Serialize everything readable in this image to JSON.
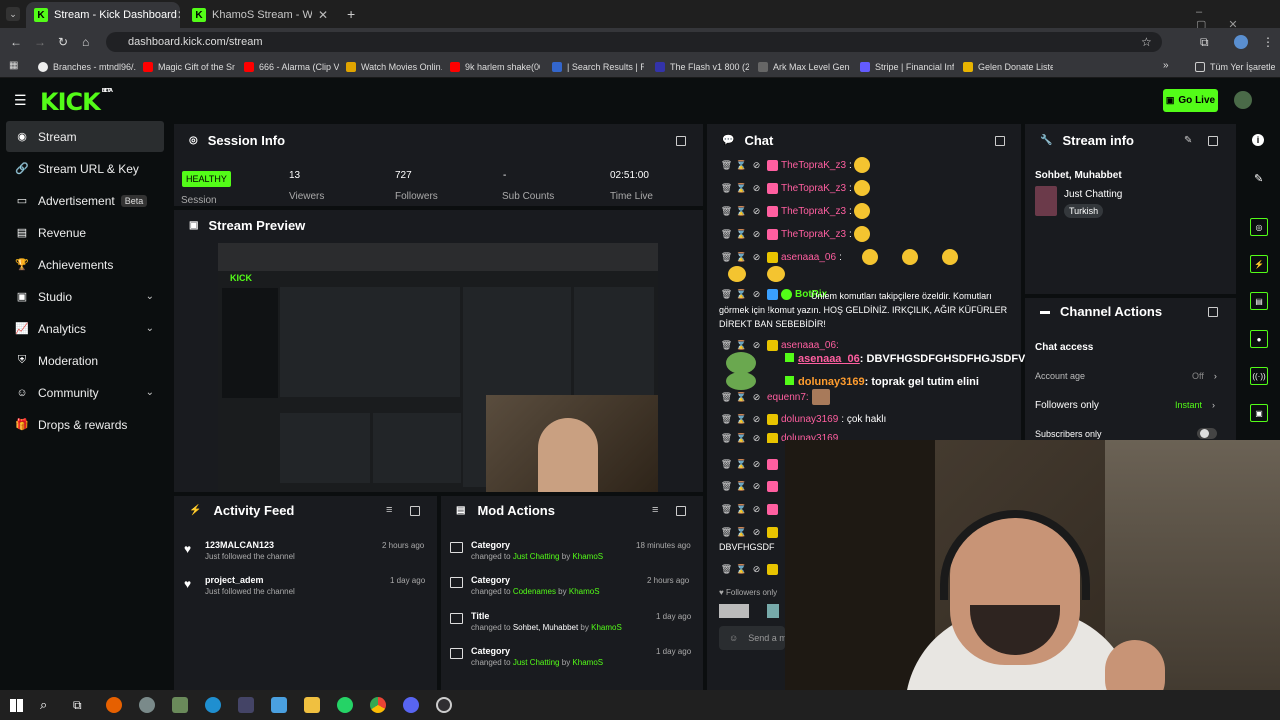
{
  "browser": {
    "tabs": [
      {
        "label": "Stream - Kick Dashboard"
      },
      {
        "label": "KhamoS Stream - Watch Live"
      }
    ],
    "url": "dashboard.kick.com/stream",
    "bookmarks": [
      "Branches - mtndl96/...",
      "Magic Gift of the Sn...",
      "666 - Alarma (Clip V...",
      "Watch Movies Onlin...",
      "9k harlem shake(00...",
      "| Search Results | Re...",
      "The Flash v1 800 (20...",
      "Ark Max Level Gene...",
      "Stripe | Financial Infr...",
      "Gelen Donate Listesi",
      "Tüm Yer İşaretleri"
    ]
  },
  "header": {
    "logo": "KICK",
    "logo_sup": "BETA",
    "go_live": "Go Live"
  },
  "sidebar": {
    "items": [
      {
        "label": "Stream"
      },
      {
        "label": "Stream URL & Key"
      },
      {
        "label": "Advertisement",
        "badge": "Beta"
      },
      {
        "label": "Revenue"
      },
      {
        "label": "Achievements"
      },
      {
        "label": "Studio"
      },
      {
        "label": "Analytics"
      },
      {
        "label": "Moderation"
      },
      {
        "label": "Community"
      },
      {
        "label": "Drops & rewards"
      }
    ]
  },
  "session": {
    "title": "Session Info",
    "status": "HEALTHY",
    "status_label": "Session",
    "viewers": "13",
    "viewers_label": "Viewers",
    "followers": "727",
    "followers_label": "Followers",
    "subs": "-",
    "subs_label": "Sub Counts",
    "time": "02:51:00",
    "time_label": "Time Live"
  },
  "preview": {
    "title": "Stream Preview"
  },
  "activity": {
    "title": "Activity Feed",
    "items": [
      {
        "name": "123MALCAN123",
        "sub": "Just followed the channel",
        "time": "2 hours ago"
      },
      {
        "name": "project_adem",
        "sub": "Just followed the channel",
        "time": "1 day ago"
      }
    ]
  },
  "mod": {
    "title": "Mod Actions",
    "items": [
      {
        "kind": "Category",
        "pre": "changed to ",
        "val": "Just Chatting",
        "by": " by ",
        "user": "KhamoS",
        "time": "18 minutes ago"
      },
      {
        "kind": "Category",
        "pre": "changed to ",
        "val": "Codenames",
        "by": " by ",
        "user": "KhamoS",
        "time": "2 hours ago"
      },
      {
        "kind": "Title",
        "pre": "changed to ",
        "val": "Sohbet, Muhabbet",
        "by": " by ",
        "user": "KhamoS",
        "time": "1 day ago"
      },
      {
        "kind": "Category",
        "pre": "changed to ",
        "val": "Just Chatting",
        "by": " by ",
        "user": "KhamoS",
        "time": "1 day ago"
      }
    ]
  },
  "chat": {
    "title": "Chat",
    "lines": [
      {
        "user": "TheTopraK_z3",
        "color": "#ff5fa0",
        "text": ":"
      },
      {
        "user": "TheTopraK_z3",
        "color": "#ff5fa0",
        "text": ":"
      },
      {
        "user": "TheTopraK_z3",
        "color": "#ff5fa0",
        "text": ":"
      },
      {
        "user": "TheTopraK_z3",
        "color": "#ff5fa0",
        "text": ":"
      },
      {
        "user": "asenaaa_06",
        "color": "#ff5fa0",
        "text": ":"
      }
    ],
    "botrix_user": "BotRix",
    "botrix_text": "Ünlem komutları takipçilere özeldir. Komutları görmek için !komut yazın. HOŞ GELDİNİZ. IRKÇILIK, AĞIR KÜFÜRLER DİREKT BAN SEBEBİDİR!",
    "overlay1_user": "asenaaa_06",
    "overlay1_text": ": DBVFHGSDFGHSDFHGJSDFVSGHVFJSHDFBJSD",
    "overlay2_user": "dolunay3169",
    "overlay2_text": ": toprak gel tutim elini",
    "asena_line": "asenaaa_06:",
    "equenn": "equenn7:",
    "dolunay_line_user": "dolunay3169",
    "dolunay_line_text": ": çok haklı",
    "dolunay_line2_user": "dolunay3169",
    "dolunay_line2_text": ": ",
    "partial_text": "DBVFHGSDF",
    "followers_only": "Followers only",
    "send_placeholder": "Send a message"
  },
  "stream_info": {
    "title": "Stream info",
    "stream_title": "Sohbet, Muhabbet",
    "category": "Just Chatting",
    "tag": "Turkish"
  },
  "channel_actions": {
    "title": "Channel Actions",
    "chat_access": "Chat access",
    "account_age": "Account age",
    "account_age_value": "Off",
    "followers_only": "Followers only",
    "followers_only_value": "Instant",
    "subscribers_only": "Subscribers only"
  },
  "colors": {
    "accent": "#53fc18",
    "panel": "#191b1f",
    "bg": "#0b0e0f"
  }
}
